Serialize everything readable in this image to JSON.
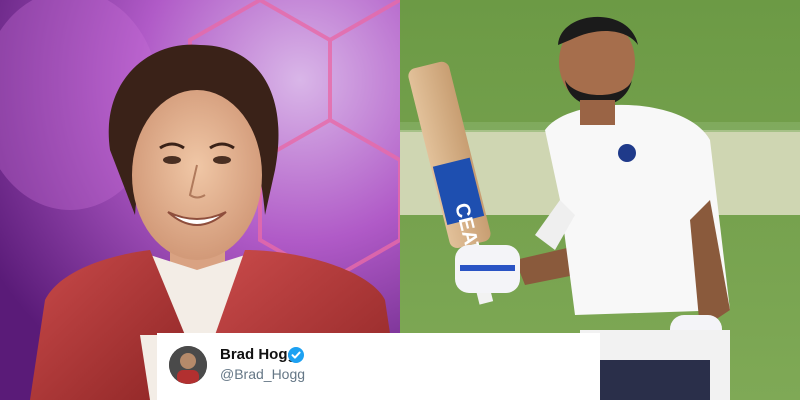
{
  "tweet": {
    "name": "Brad Hogg",
    "handle": "@Brad_Hogg",
    "verified_icon": "verified-badge-icon"
  },
  "photos": {
    "left": "portrait-photo",
    "right": "cricketer-photo",
    "bat_brand": "CEAT"
  }
}
